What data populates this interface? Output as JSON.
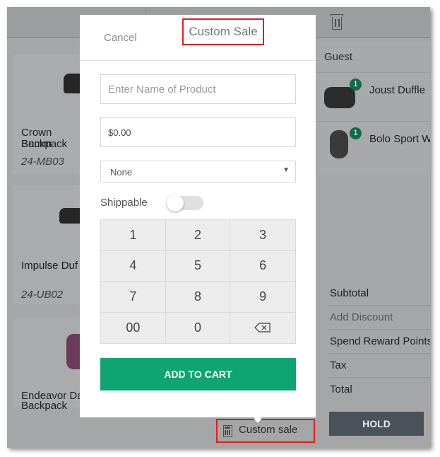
{
  "background": {
    "products": [
      {
        "name_line1": "Crown Summ",
        "name_line2": "Backpack",
        "sku": "24-MB03"
      },
      {
        "name_line1": "Impulse Duf",
        "name_line2": "",
        "sku": "24-UB02"
      },
      {
        "name_line1": "Endeavor Da",
        "name_line2": "Backpack",
        "sku": ""
      }
    ],
    "cart": {
      "customer": "Guest",
      "items": [
        {
          "qty": "1",
          "name": "Joust Duffle",
          "icon": "duffle-bag"
        },
        {
          "qty": "1",
          "name": "Bolo Sport W",
          "icon": "watch"
        }
      ]
    },
    "totals": {
      "subtotal_label": "Subtotal",
      "discount_label": "Add Discount",
      "reward_label": "Spend Reward Points",
      "tax_label": "Tax",
      "total_label": "Total"
    },
    "hold_label": "HOLD",
    "custom_sale_label": "Custom sale",
    "icons": {
      "trash": "trash-icon",
      "calculator": "calculator-icon"
    }
  },
  "modal": {
    "cancel_label": "Cancel",
    "title": "Custom Sale",
    "product_placeholder": "Enter Name of Product",
    "price_value": "$0.00",
    "tax_class_selected": "None",
    "shippable_label": "Shippable",
    "shippable_enabled": false,
    "keypad_keys": [
      "1",
      "2",
      "3",
      "4",
      "5",
      "6",
      "7",
      "8",
      "9",
      "00",
      "0"
    ],
    "add_to_cart_label": "ADD TO CART"
  },
  "colors": {
    "accent_green": "#0ea572",
    "highlight_red": "#e01e1e",
    "hold_button": "#4a5158"
  }
}
